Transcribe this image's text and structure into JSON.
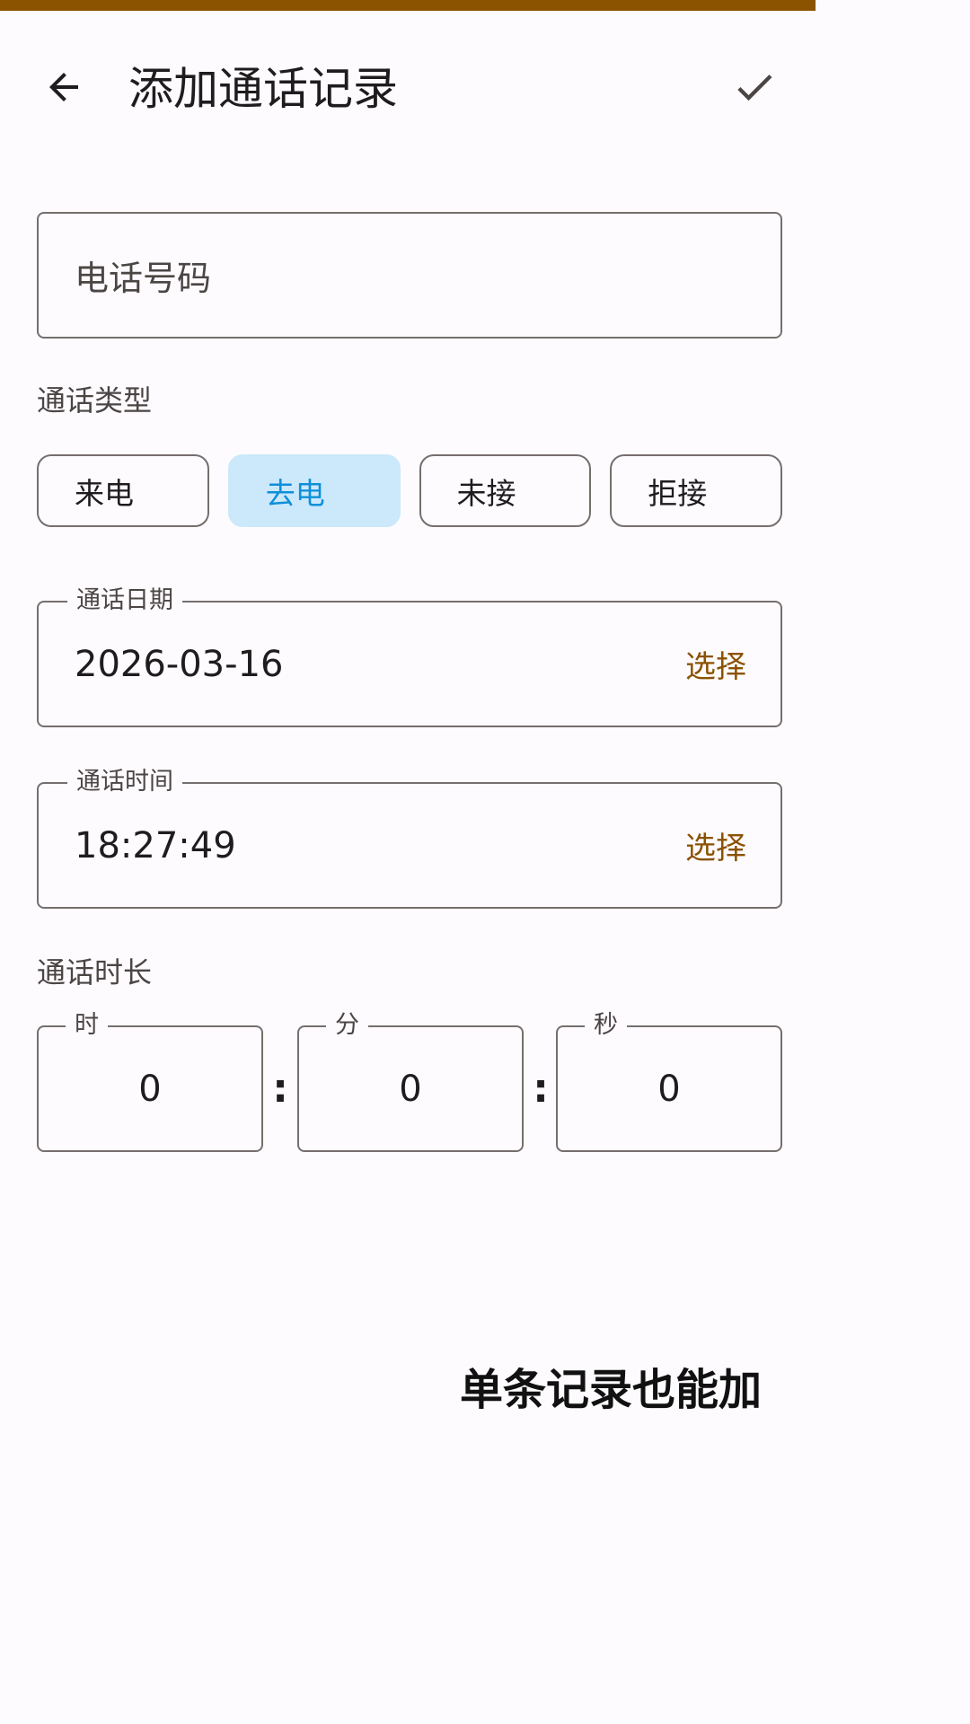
{
  "app_bar": {
    "title": "添加通话记录",
    "back_icon": "arrow-back-icon",
    "confirm_icon": "check-icon"
  },
  "phone": {
    "placeholder": "电话号码",
    "value": ""
  },
  "call_type": {
    "label": "通话类型",
    "options": [
      "来电",
      "去电",
      "未接",
      "拒接"
    ],
    "selected": "去电"
  },
  "date": {
    "label": "通话日期",
    "value": "2026-03-16",
    "action": "选择"
  },
  "time": {
    "label": "通话时间",
    "value": "18:27:49",
    "action": "选择"
  },
  "duration": {
    "label": "通话时长",
    "hours_label": "时",
    "hours": "0",
    "minutes_label": "分",
    "minutes": "0",
    "seconds_label": "秒",
    "seconds": "0",
    "separator": ":"
  },
  "caption": "单条记录也能加",
  "colors": {
    "accent": "#8b5200",
    "chip_selected_bg": "#cce8fb",
    "chip_selected_text": "#0e8fd8",
    "outline": "#756f6d",
    "background": "#fdfbfe"
  }
}
